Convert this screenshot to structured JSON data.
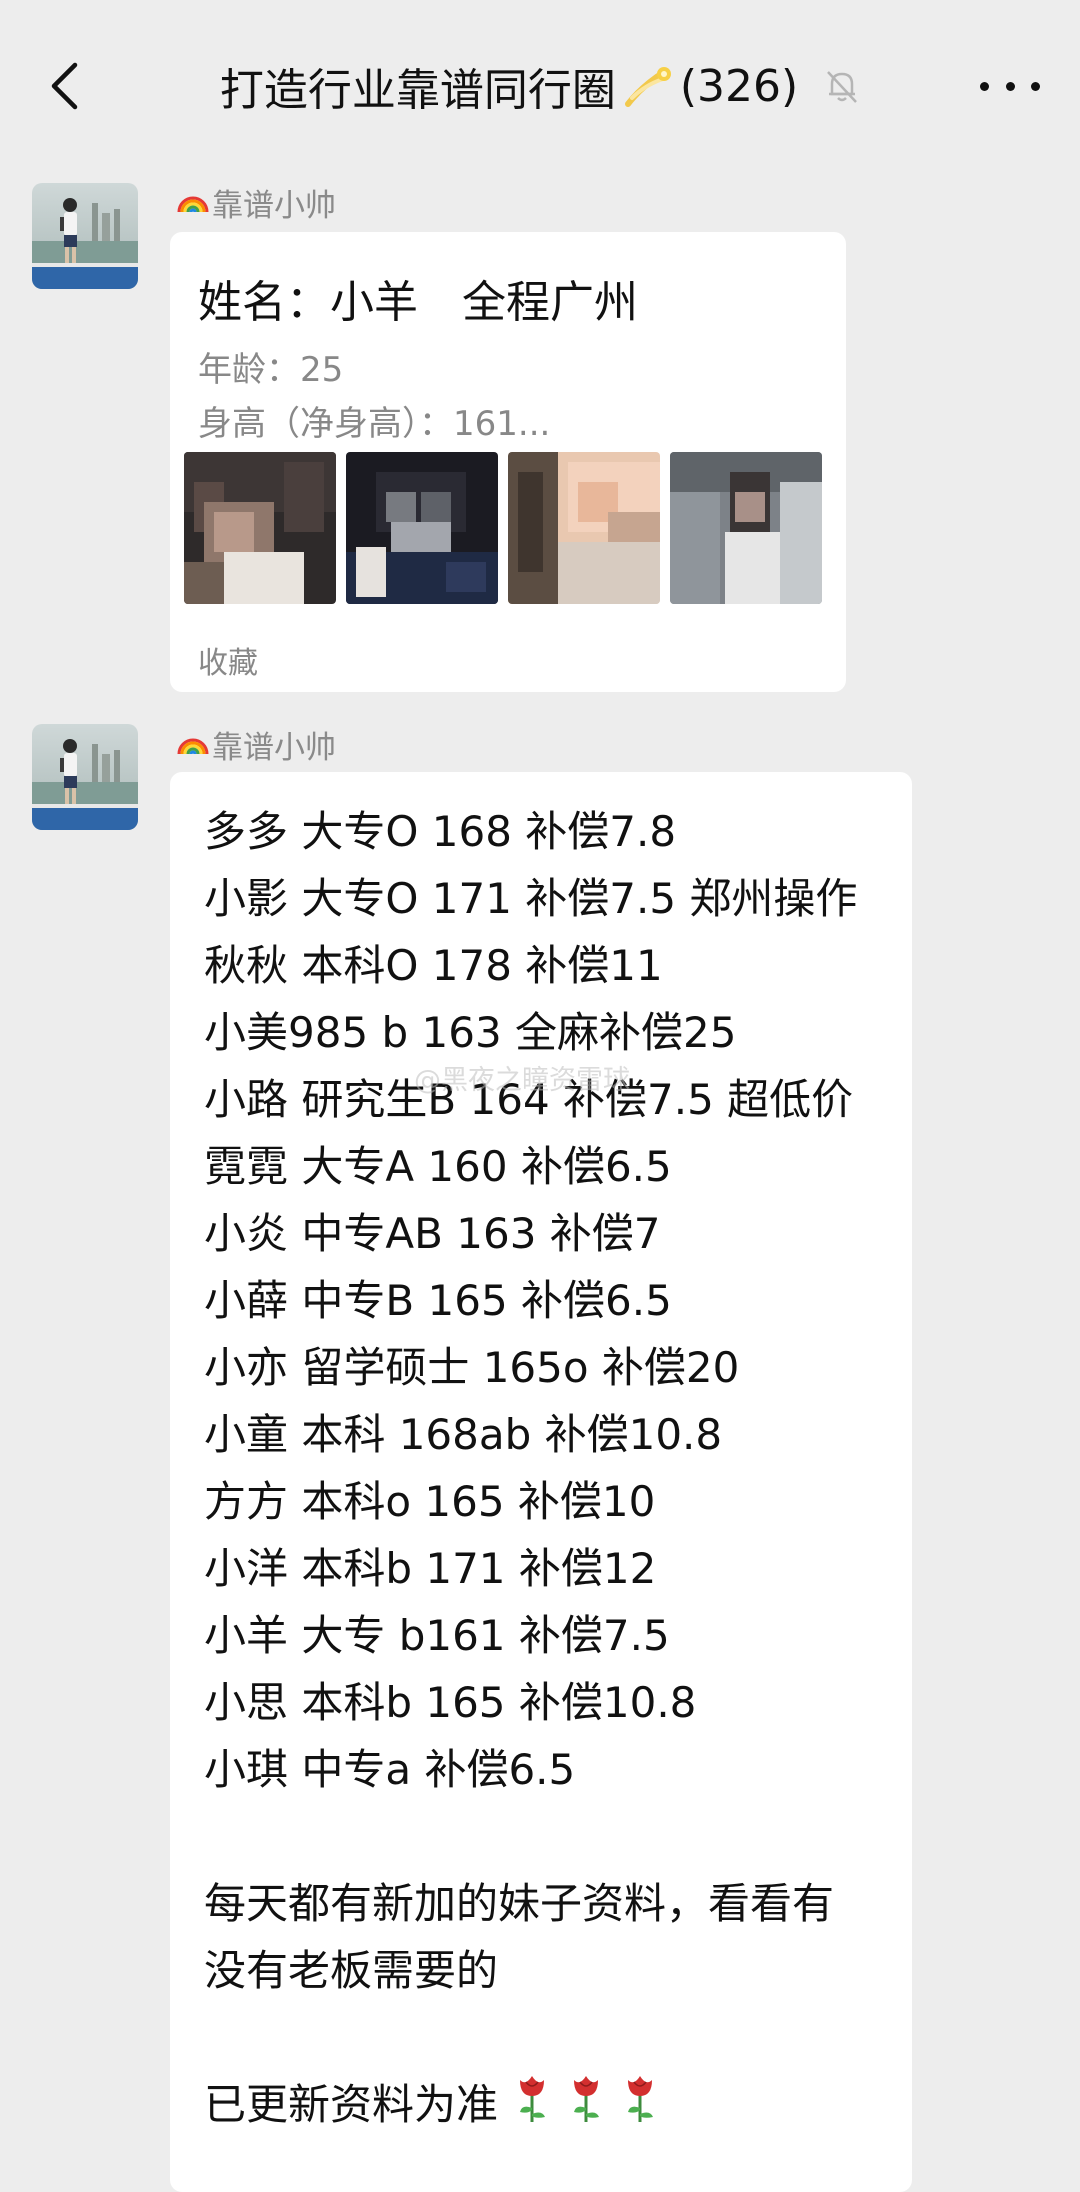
{
  "header": {
    "back_icon": "chevron-left-icon",
    "title_prefix": "打造行业靠谱同行圈",
    "title_icon": "comet-emoji-icon",
    "member_count": "(326)",
    "mute_icon": "bell-muted-icon",
    "more_icon": "more-dots-icon"
  },
  "messages": [
    {
      "sender_icon": "rainbow-emoji-icon",
      "sender": "靠谱小帅",
      "card": {
        "title": "姓名：小羊　全程广州",
        "age": "年龄：25",
        "height": "身高（净身高）：161...",
        "footer": "收藏",
        "thumbnail_count": 4
      }
    },
    {
      "sender_icon": "rainbow-emoji-icon",
      "sender": "靠谱小帅",
      "lines": [
        "多多 大专O 168 补偿7.8",
        "小影 大专O 171 补偿7.5 郑州操作",
        "秋秋 本科O 178 补偿11",
        "小美985 b 163 全麻补偿25",
        "小路 研究生B 164 补偿7.5 超低价",
        "霓霓 大专A 160 补偿6.5",
        "小炎 中专AB 163 补偿7",
        "小薛 中专B 165 补偿6.5",
        "小亦 留学硕士 165o 补偿20",
        "小童 本科 168ab 补偿10.8",
        "方方 本科o 165 补偿10",
        "小洋 本科b 171 补偿12",
        "小羊 大专 b161 补偿7.5",
        "小思 本科b 165 补偿10.8",
        "小琪 中专a 补偿6.5"
      ],
      "note_line_1": "每天都有新加的妹子资料，看看有",
      "note_line_2": "没有老板需要的",
      "closing": "已更新资料为准",
      "closing_icon": "rose-emoji-icon"
    }
  ],
  "watermark": "@黑夜之瞳资雷球",
  "colors": {
    "background": "#ededed",
    "bubble": "#ffffff",
    "secondary_text": "#888888"
  }
}
